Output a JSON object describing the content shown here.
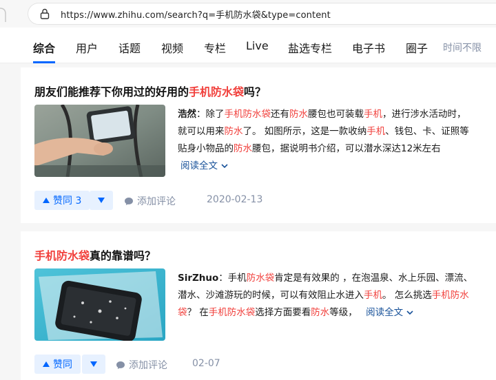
{
  "browser": {
    "url": "https://www.zhihu.com/search?q=手机防水袋&type=content"
  },
  "tabs": [
    {
      "label": "综合",
      "active": true
    },
    {
      "label": "用户"
    },
    {
      "label": "话题"
    },
    {
      "label": "视频"
    },
    {
      "label": "专栏"
    },
    {
      "label": "Live"
    },
    {
      "label": "盐选专栏"
    },
    {
      "label": "电子书"
    },
    {
      "label": "圈子"
    }
  ],
  "time_filter": "时间不限",
  "results": [
    {
      "title_pre": "朋友们能推荐下你用过的好用的",
      "title_hl": "手机防水袋",
      "title_post": "吗？",
      "author": "浩然",
      "sep": "：",
      "line1": [
        "除了",
        "手机防水袋",
        "还有",
        "防水",
        "腰包也可装载",
        "手机",
        "，进行涉水活动时，"
      ],
      "line2": [
        "就可以用来",
        "防水",
        "了。 如图所示，这是一款收纳",
        "手机",
        "、钱包、卡、证照等"
      ],
      "line3": [
        "贴身小物品的",
        "防水",
        "腰包，据说明书介绍，可以潜水深达12米左右"
      ],
      "read_more": "阅读全文",
      "upvote": "赞同 3",
      "comment": "添加评论",
      "date": "2020-02-13",
      "thumb_icon": "waterproof-pouch-photo"
    },
    {
      "title_hl": "手机防水袋",
      "title_post": "真的靠谱吗？",
      "author": "SirZhuo",
      "sep": "：",
      "line1": [
        "手机",
        "防水袋",
        "肯定是有效果的 ，在泡温泉、水上乐园、漂流、"
      ],
      "line2": [
        "潜水、沙滩游玩的时候，可以有效阻止水进入",
        "手机",
        "。 怎么挑选",
        "手机防水"
      ],
      "line3": [
        "袋",
        "？ 在",
        "手机防水袋",
        "选择方面要看",
        "防水",
        "等级，"
      ],
      "read_more": "阅读全文",
      "upvote": "赞同",
      "comment": "添加评论",
      "date": "02-07",
      "thumb_icon": "phone-in-waterproof-bag-photo"
    }
  ],
  "colors": {
    "accent": "#0066ff",
    "highlight": "#f1403c",
    "link": "#175199",
    "meta": "#8590a6"
  }
}
